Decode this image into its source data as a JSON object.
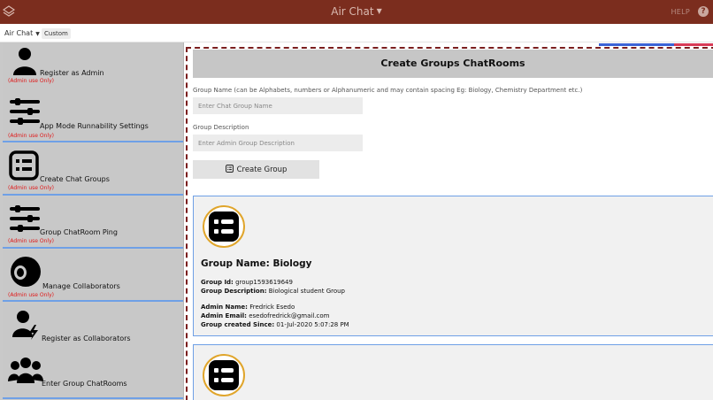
{
  "topbar": {
    "title": "Air Chat",
    "help_label": "HELP",
    "help_icon_glyph": "?"
  },
  "subbar": {
    "app_select": "Air Chat",
    "badge": "Custom"
  },
  "sidebar": {
    "items": [
      {
        "label": "Register as Admin",
        "note": "(Admin use Only)",
        "icon": "user-icon"
      },
      {
        "label": "App Mode Runnability Settings",
        "note": "(Admin use Only)",
        "icon": "sliders-icon"
      },
      {
        "label": "Create Chat Groups",
        "note": "(Admin use Only)",
        "icon": "list-box-icon"
      },
      {
        "label": "Group ChatRoom Ping",
        "note": "(Admin use Only)",
        "icon": "sliders-icon"
      },
      {
        "label": "Manage Collaborators",
        "note": "(Admin use Only)",
        "icon": "toggle-icon"
      },
      {
        "label": "Register as Collaborators",
        "note": "",
        "icon": "user-bolt-icon"
      },
      {
        "label": "Enter Group ChatRooms",
        "note": "",
        "icon": "users-icon"
      }
    ]
  },
  "main": {
    "heading": "Create Groups ChatRooms",
    "group_name_label": "Group Name (can be Alphabets, numbers or Alphanumeric and may contain spacing Eg: Biology, Chemistry Department etc.)",
    "group_name_placeholder": "Enter Chat Group Name",
    "group_desc_label": "Group Description",
    "group_desc_placeholder": "Enter Admin Group Description",
    "create_button": "Create Group"
  },
  "groups": [
    {
      "name": "Group Name: Biology",
      "id_label": "Group Id:",
      "id_value": "group1593619649",
      "desc_label": "Group Description:",
      "desc_value": "Biological student Group",
      "admin_name_label": "Admin Name:",
      "admin_name_value": "Fredrick Esedo",
      "admin_email_label": "Admin Email:",
      "admin_email_value": "esedofredrick@gmail.com",
      "created_label": "Group created Since:",
      "created_value": "01-Jul-2020 5:07:28 PM"
    }
  ],
  "colors": {
    "topbar": "#7b2d1e",
    "sidebar": "#c8c8c8",
    "accent_blue": "#6fa0e6",
    "note_red": "#e01818",
    "avatar_ring": "#e0a52b"
  }
}
